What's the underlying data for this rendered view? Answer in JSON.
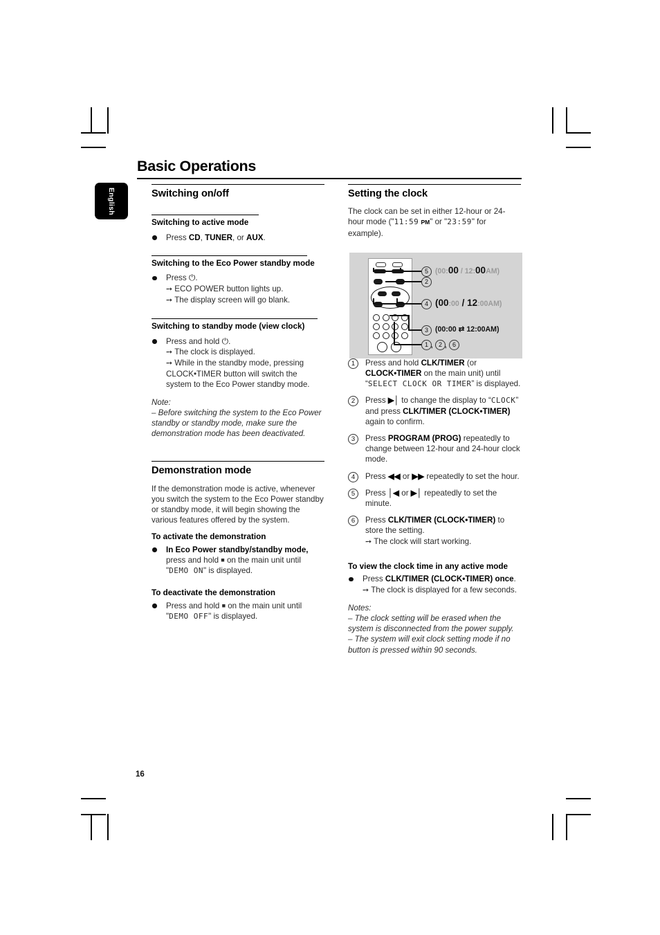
{
  "page": {
    "title": "Basic Operations",
    "language_tab": "English",
    "number": "16"
  },
  "left_column": {
    "section1": {
      "heading": "Switching on/off",
      "sub1": {
        "heading": "Switching to active mode",
        "bullet": "Press CD, TUNER, or AUX.",
        "bullet_parts": [
          "Press ",
          "CD",
          ", ",
          "TUNER",
          ", or ",
          "AUX",
          "."
        ]
      },
      "sub2": {
        "heading": "Switching to the Eco Power standby mode",
        "bullet": "Press ⏻.",
        "results": [
          "ECO POWER button lights up.",
          "The display screen will go blank."
        ]
      },
      "sub3": {
        "heading": "Switching to standby mode (view clock)",
        "bullet": "Press and hold ⏻.",
        "results": [
          "The clock is displayed.",
          "While in the standby mode, pressing CLOCK•TIMER button will switch the system to the Eco Power standby mode."
        ]
      },
      "note_label": "Note:",
      "note": "–  Before switching the system to the Eco Power standby or standby mode, make sure the demonstration mode has been deactivated."
    },
    "section2": {
      "heading": "Demonstration mode",
      "intro": "If the demonstration mode is active, whenever you switch the system to the Eco Power standby or standby mode, it will begin showing the various features offered by the system.",
      "activate": {
        "heading": "To activate the demonstration",
        "text_before": "In Eco Power standby/standby mode, press and hold ■ on the main unit until \"",
        "lcd": "DEMO ON",
        "text_after": "\" is displayed."
      },
      "deactivate": {
        "heading": "To deactivate the demonstration",
        "text_before": "Press and hold ■ on the main unit until \"",
        "lcd": "DEMO OFF",
        "text_after": "\" is displayed."
      }
    }
  },
  "right_column": {
    "heading": "Setting the clock",
    "intro_a": "The clock can be set in either 12-hour or 24-hour mode (\"",
    "intro_lcd1": "11:59",
    "intro_pm": "PM",
    "intro_b": "\" or \"",
    "intro_lcd2": "23:59",
    "intro_c": "\" for example).",
    "figure": {
      "callout5": {
        "num": "5",
        "text": "(00:00 / 12:00AM)",
        "parts": {
          "gray1": "(00:",
          "black1": "00",
          "gray2": " / 12:",
          "black2": "00",
          "gray3": "AM)"
        }
      },
      "callout2": {
        "num": "2"
      },
      "callout4": {
        "num": "4",
        "text": "(00:00 / 12:00AM)",
        "parts": {
          "black1": "(00",
          "gray1": ":00",
          "black2": " / 12",
          "gray2": ":00AM)"
        }
      },
      "callout3": {
        "num": "3",
        "text": "(00:00 ⇄ 12:00AM)"
      },
      "callout126": {
        "text": "1 , 2 , 6",
        "nums": [
          "1",
          "2",
          "6"
        ]
      }
    },
    "steps": [
      {
        "num": "1",
        "parts": [
          "Press and hold ",
          "CLK/TIMER",
          " (or ",
          "CLOCK•TIMER",
          " on the main unit) until “"
        ],
        "lcd": "SELECT CLOCK OR TIMER",
        "tail": "” is displayed."
      },
      {
        "num": "2",
        "parts": [
          "Press ",
          "▶❙",
          " to change the display to “"
        ],
        "lcd": "CLOCK",
        "tail_parts": [
          "” and press ",
          "CLK/TIMER (CLOCK•TIMER)",
          " again to confirm."
        ]
      },
      {
        "num": "3",
        "parts": [
          "Press ",
          "PROGRAM (PROG)",
          " repeatedly to change between 12-hour and 24-hour clock mode."
        ]
      },
      {
        "num": "4",
        "parts": [
          "Press ",
          "◀◀",
          " or ",
          "▶▶",
          " repeatedly to set the hour."
        ]
      },
      {
        "num": "5",
        "parts": [
          "Press ",
          "❙◀",
          " or ",
          "▶❙",
          " repeatedly to set the minute."
        ]
      },
      {
        "num": "6",
        "parts": [
          "Press ",
          "CLK/TIMER (CLOCK•TIMER)",
          " to store the setting."
        ],
        "result": "The clock will start working."
      }
    ],
    "view_clock": {
      "heading": "To view the clock time in any active mode",
      "bullet_parts": [
        "Press ",
        "CLK/TIMER (CLOCK•TIMER) once",
        "."
      ],
      "result": "The clock is displayed for a few seconds."
    },
    "notes_label": "Notes:",
    "notes": [
      "–  The clock setting will be erased when the system is disconnected from the power supply.",
      "–  The system will exit clock setting mode if no button is pressed within 90 seconds."
    ]
  }
}
